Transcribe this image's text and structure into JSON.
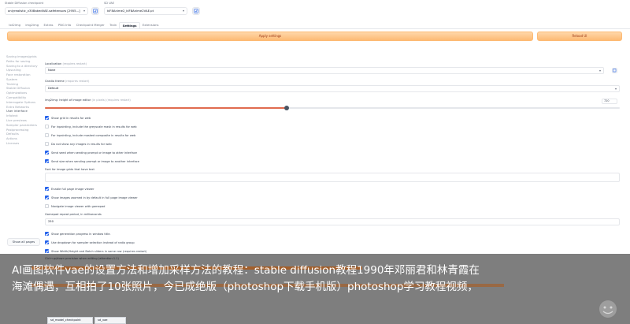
{
  "top": {
    "checkpoint_label": "Stable Diffusion checkpoint",
    "checkpoint_value": "onlyrealistic_v30BakedVAE.safetensors [2955...]",
    "vae_label": "SD VAE",
    "vae_value": "klF8Anime2_klF8Anime2VAE.pt"
  },
  "tabs": [
    "txt2img",
    "img2img",
    "Extras",
    "PNG Info",
    "Checkpoint Merger",
    "Train",
    "Settings",
    "Extensions"
  ],
  "active_tab": "Settings",
  "buttons": {
    "apply": "Apply settings",
    "reload": "Reload UI",
    "show_all": "Show all pages"
  },
  "sidebar": {
    "items": [
      "Saving images/grids",
      "Paths for saving",
      "Saving to a directory",
      "Upscaling",
      "Face restoration",
      "System",
      "Training",
      "Stable Diffusion",
      "Optimizations",
      "Compatibility",
      "Interrogate Options",
      "Extra Networks",
      "User interface",
      "Infotext",
      "Live previews",
      "Sampler parameters",
      "Postprocessing",
      "Defaults",
      "Actions",
      "Licenses"
    ],
    "selected": "User interface"
  },
  "settings": {
    "localization_label": "Localization",
    "localization_note": "(requires restart)",
    "localization_value": "None",
    "theme_label": "Gradio theme",
    "theme_note": "(requires restart)",
    "theme_value": "Default",
    "height_label": "img2img: height of image editor",
    "height_note": "(in pixels) (requires restart)",
    "height_value": "720",
    "height_fraction": 0.42,
    "checkboxes_a": [
      {
        "label": "Show grid in results for web",
        "checked": true
      },
      {
        "label": "For inpainting, include the greyscale mask in results for web",
        "checked": false
      },
      {
        "label": "For inpainting, include masked composite in results for web",
        "checked": false
      },
      {
        "label": "Do not show any images in results for web",
        "checked": false
      },
      {
        "label": "Send seed when sending prompt or image to other interface",
        "checked": true
      },
      {
        "label": "Send size when sending prompt or image to another interface",
        "checked": true
      }
    ],
    "font_label": "Font for image grids that have text",
    "checkboxes_b": [
      {
        "label": "Enable full page image viewer",
        "checked": true
      },
      {
        "label": "Show images zoomed in by default in full page image viewer",
        "checked": true
      },
      {
        "label": "Navigate image viewer with gamepad",
        "checked": false
      }
    ],
    "gamepad_label": "Gamepad repeat period, in milliseconds",
    "gamepad_value": "250",
    "checkboxes_c": [
      {
        "label": "Show generation progress in window title.",
        "checked": true
      },
      {
        "label": "Use dropdown for sampler selection instead of radio group",
        "checked": true
      },
      {
        "label": "Show Width/Height and Batch sliders in same row (requires restart)",
        "checked": true
      }
    ],
    "ctrl_label": "Ctrl+up/down precision when editing (attention:1.1)",
    "bottom_dd_a": "sd_model_checkpoint",
    "bottom_dd_b": "sd_vae"
  },
  "overlay": {
    "text": "AI画图软件vae的设置方法和增加采样方法的教程：stable diffusion教程1990年邓丽君和林青霞在海滩偶遇，互相拍了10张照片，今已成绝版（photoshop下载手机版）photoshop学习教程视频，"
  },
  "colors": {
    "accent": "#e06c4f",
    "button_bg": "#fdba74",
    "checkbox": "#2563eb"
  }
}
